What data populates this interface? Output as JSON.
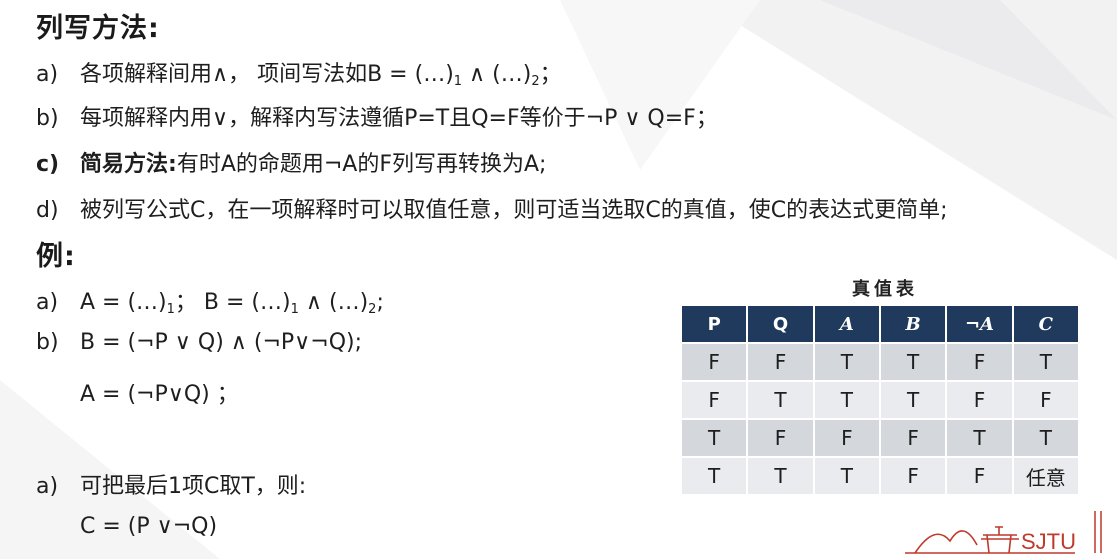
{
  "heading_method": "列写方法:",
  "method_items": [
    {
      "marker": "a)",
      "text": "各项解释间用∧， 项间写法如B = (…)",
      "sub1": "1",
      "mid": " ∧ (…)",
      "sub2": "2",
      "tail": "；"
    },
    {
      "marker": "b)",
      "text": "每项解释内用∨，解释内写法遵循P=T且Q=F等价于¬P ∨ Q=F；"
    },
    {
      "marker": "c)",
      "bold": "简易方法:",
      "text": "有时A的命题用¬A的F列写再转换为A;"
    },
    {
      "marker": "d)",
      "text": "被列写公式C，在一项解释时可以取值任意，则可适当选取C的真值，使C的表达式更简单;"
    }
  ],
  "heading_example": "例:",
  "example_items": [
    {
      "marker": "a)",
      "text": "A = (…)",
      "sub1": "1",
      "mid": "；  B = (…)",
      "sub2": "1",
      "mid2": " ∧ (…)",
      "sub3": "2",
      "tail": ";"
    },
    {
      "marker": "b)",
      "text": "B = (¬P ∨ Q) ∧ (¬P∨¬Q);"
    },
    {
      "marker": "",
      "text": "A = (¬P∨Q) ；"
    }
  ],
  "conclusion_items": [
    {
      "marker": "a)",
      "text": "可把最后1项C取T，则:"
    },
    {
      "marker": "",
      "text": "C = (P ∨¬Q)"
    }
  ],
  "truth_table": {
    "caption": "真值表",
    "headers": [
      "P",
      "Q",
      "A",
      "B",
      "¬A",
      "C"
    ],
    "rows": [
      [
        "F",
        "F",
        "T",
        "T",
        "F",
        "T"
      ],
      [
        "F",
        "T",
        "T",
        "T",
        "F",
        "F"
      ],
      [
        "T",
        "F",
        "F",
        "F",
        "T",
        "T"
      ],
      [
        "T",
        "T",
        "T",
        "F",
        "F",
        "任意"
      ]
    ]
  },
  "logo_text": "SJTU",
  "colors": {
    "table_header": "#1f3a5c",
    "row_odd": "#d4d7dc",
    "row_even": "#e9ebee",
    "logo_red": "#c0392b"
  }
}
